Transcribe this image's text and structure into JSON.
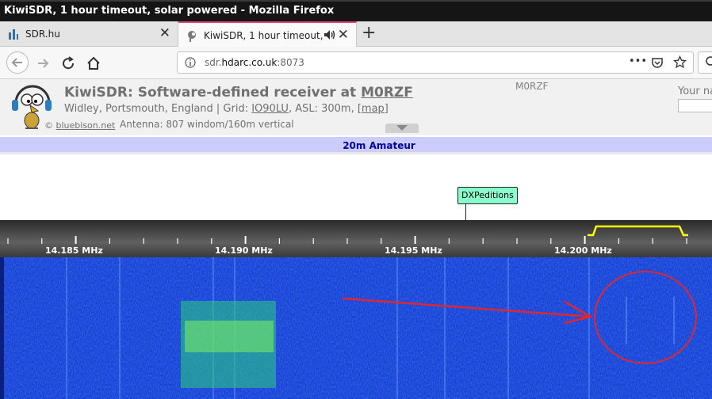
{
  "window": {
    "title": "KiwiSDR, 1 hour timeout, solar powered - Mozilla Firefox"
  },
  "tabs": [
    {
      "label": "SDR.hu",
      "close": "✕"
    },
    {
      "label": "KiwiSDR, 1 hour timeout, s",
      "close": "✕"
    }
  ],
  "new_tab": "+",
  "nav": {
    "url_host_prefix": "sdr.",
    "url_domain": "hdarc.co.uk",
    "url_suffix": ":8073",
    "more": "•••"
  },
  "header": {
    "title_prefix": "KiwiSDR: Software-defined receiver at ",
    "title_call": "M0RZF",
    "location_prefix": "Widley, Portsmouth, England | Grid: ",
    "grid": "IO90LU",
    "asl": ", ASL: 300m, ",
    "map": "[map]",
    "credit_sym": "© ",
    "credit": "bluebison.net",
    "antenna": "Antenna: 807 windom/160m vertical",
    "callsign": "M0RZF",
    "your_name": "Your na"
  },
  "band": {
    "label": "20m Amateur"
  },
  "marker": {
    "label": "DXPeditions"
  },
  "scale": {
    "labels": [
      "14.185 MHz",
      "14.190 MHz",
      "14.195 MHz",
      "14.200 MHz"
    ]
  },
  "colors": {
    "band_bg": "#ccccff",
    "band_text": "#0000a0",
    "marker_bg": "#88ffcc",
    "passband": "#ffff00",
    "waterfall": "#1a3ed6",
    "annotation": "#e0262e"
  }
}
